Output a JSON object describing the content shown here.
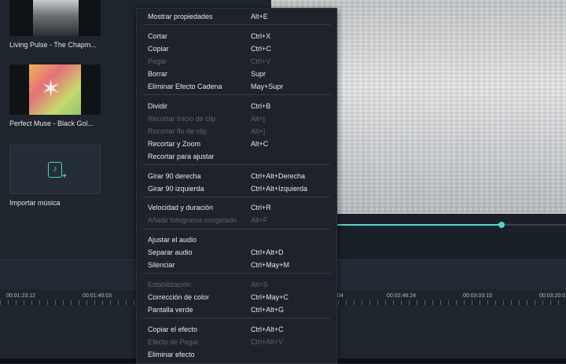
{
  "library": {
    "items": [
      {
        "title": "Living Pulse - The Chapm...",
        "kind": "audio-track"
      },
      {
        "title": "Perfect Muse - Black Gol...",
        "kind": "audio-track"
      },
      {
        "title": "Importar música",
        "kind": "import"
      }
    ],
    "import_icon": "music-note-plus-icon"
  },
  "preview": {
    "progress": 0.78,
    "accent_color": "#4fd8c7"
  },
  "timeline": {
    "ticks": [
      "00:01:23:12",
      "00:01:40:03",
      "04",
      "00:02:46:24",
      "00:03:03:15",
      "00:03:20:0"
    ]
  },
  "context_menu": {
    "groups": [
      [
        {
          "label": "Mostrar propiedades",
          "shortcut": "Alt+E",
          "enabled": true
        }
      ],
      [
        {
          "label": "Cortar",
          "shortcut": "Ctrl+X",
          "enabled": true
        },
        {
          "label": "Copiar",
          "shortcut": "Ctrl+C",
          "enabled": true
        },
        {
          "label": "Pegar",
          "shortcut": "Ctrl+V",
          "enabled": false
        },
        {
          "label": "Borrar",
          "shortcut": "Supr",
          "enabled": true
        },
        {
          "label": "Eliminar Efecto Cadena",
          "shortcut": "May+Supr",
          "enabled": true
        }
      ],
      [
        {
          "label": "Dividir",
          "shortcut": "Ctrl+B",
          "enabled": true
        },
        {
          "label": "Recortar Inicio de clip",
          "shortcut": "Alt+[",
          "enabled": false
        },
        {
          "label": "Recortar fin de clip",
          "shortcut": "Alt+]",
          "enabled": false
        },
        {
          "label": "Recortar y Zoom",
          "shortcut": "Alt+C",
          "enabled": true
        },
        {
          "label": "Recortar para ajustar",
          "shortcut": "",
          "enabled": true
        }
      ],
      [
        {
          "label": "Girar 90 derecha",
          "shortcut": "Ctrl+Alt+Derecha",
          "enabled": true
        },
        {
          "label": "Girar 90 izquierda",
          "shortcut": "Ctrl+Alt+Izquierda",
          "enabled": true
        }
      ],
      [
        {
          "label": "Velocidad y duración",
          "shortcut": "Ctrl+R",
          "enabled": true
        },
        {
          "label": "Añadir fotograma congelado",
          "shortcut": "Alt+F",
          "enabled": false
        }
      ],
      [
        {
          "label": "Ajustar el audio",
          "shortcut": "",
          "enabled": true
        },
        {
          "label": "Separar audio",
          "shortcut": "Ctrl+Alt+D",
          "enabled": true
        },
        {
          "label": "Silenciar",
          "shortcut": "Ctrl+May+M",
          "enabled": true
        }
      ],
      [
        {
          "label": "Estabilización",
          "shortcut": "Alt+S",
          "enabled": false
        },
        {
          "label": "Corrección de color",
          "shortcut": "Ctrl+May+C",
          "enabled": true
        },
        {
          "label": "Pantalla verde",
          "shortcut": "Ctrl+Alt+G",
          "enabled": true
        }
      ],
      [
        {
          "label": "Copiar el efecto",
          "shortcut": "Ctrl+Alt+C",
          "enabled": true
        },
        {
          "label": "Efecto de Pegar",
          "shortcut": "Ctrl+Alt+V",
          "enabled": false
        },
        {
          "label": "Eliminar efecto",
          "shortcut": "",
          "enabled": true
        }
      ]
    ]
  }
}
